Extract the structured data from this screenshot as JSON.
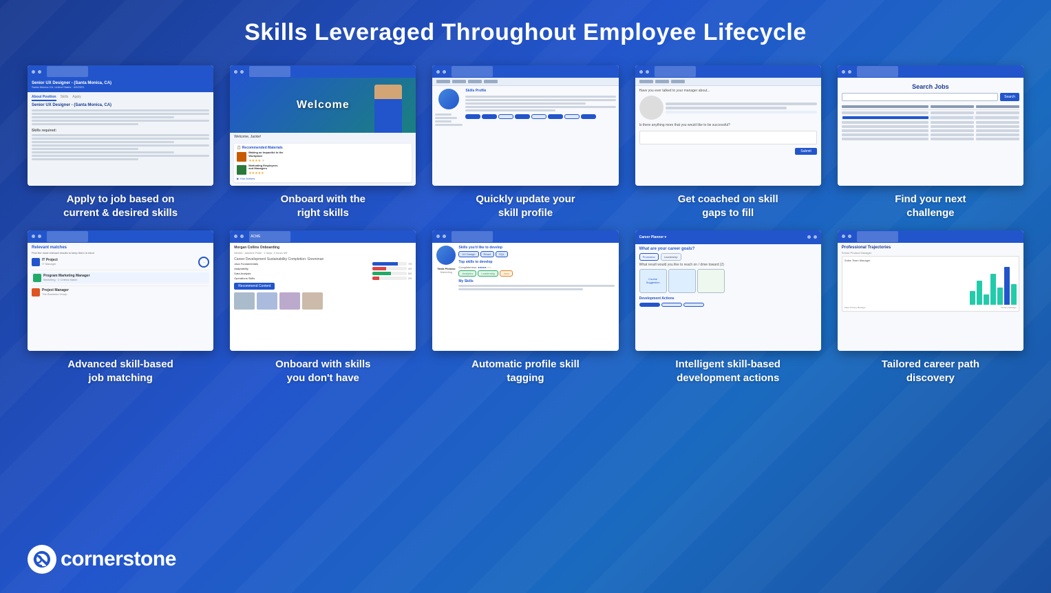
{
  "page": {
    "title": "Skills Leveraged Throughout Employee Lifecycle",
    "background": "blue-gradient"
  },
  "grid": {
    "row1": [
      {
        "id": "screen-apply-job",
        "label": "Apply to job based on\ncurrent & desired skills",
        "screen_type": "job-listing"
      },
      {
        "id": "screen-onboard-right",
        "label": "Onboard with the\nright skills",
        "screen_type": "welcome"
      },
      {
        "id": "screen-update-skills",
        "label": "Quickly update your\nskill profile",
        "screen_type": "skill-profile"
      },
      {
        "id": "screen-coached",
        "label": "Get coached on skill\ngaps to fill",
        "screen_type": "coaching"
      },
      {
        "id": "screen-next-challenge",
        "label": "Find your next\nchallenge",
        "screen_type": "job-search"
      }
    ],
    "row2": [
      {
        "id": "screen-skill-matching",
        "label": "Advanced skill-based\njob matching",
        "screen_type": "job-matching"
      },
      {
        "id": "screen-onboard-skills",
        "label": "Onboard with skills\nyou don't have",
        "screen_type": "onboard-skills"
      },
      {
        "id": "screen-auto-tagging",
        "label": "Automatic profile skill\ntagging",
        "screen_type": "auto-tagging"
      },
      {
        "id": "screen-dev-actions",
        "label": "Intelligent skill-based\ndevelopment actions",
        "screen_type": "dev-actions"
      },
      {
        "id": "screen-career-path",
        "label": "Tailored career path\ndiscovery",
        "screen_type": "career-path"
      }
    ]
  },
  "logo": {
    "brand_name": "cornerstone",
    "icon": "C"
  }
}
